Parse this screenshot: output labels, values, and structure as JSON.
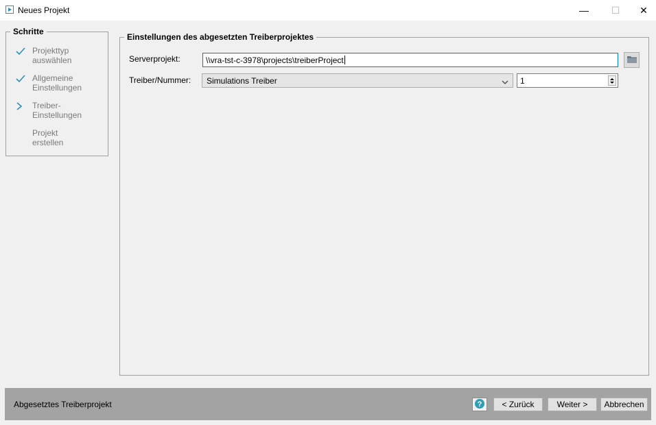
{
  "window": {
    "title": "Neues Projekt",
    "minimize_glyph": "—",
    "maximize_glyph": "☐",
    "close_glyph": "✕"
  },
  "steps": {
    "title": "Schritte",
    "items": [
      {
        "label": "Projekttyp\nauswählen",
        "state": "done",
        "icon": "check-icon"
      },
      {
        "label": "Allgemeine\nEinstellungen",
        "state": "done",
        "icon": "check-icon"
      },
      {
        "label": "Treiber-\nEinstellungen",
        "state": "current",
        "icon": "chevron-right-icon"
      },
      {
        "label": "Projekt\nerstellen",
        "state": "pending",
        "icon": ""
      }
    ],
    "accent_color": "#2b8fb8"
  },
  "main": {
    "title": "Einstellungen des abgesetzten Treiberprojektes",
    "server_project_label": "Serverprojekt:",
    "server_project_value": "\\\\vra-tst-c-3978\\projects\\treiberProject",
    "driver_label": "Treiber/Nummer:",
    "driver_value": "Simulations Treiber",
    "driver_number": "1"
  },
  "footer": {
    "status_text": "Abgesetztes Treiberprojekt",
    "help_icon": "help-icon",
    "back_label": "< Zurück",
    "next_label": "Weiter >",
    "cancel_label": "Abbrechen"
  }
}
